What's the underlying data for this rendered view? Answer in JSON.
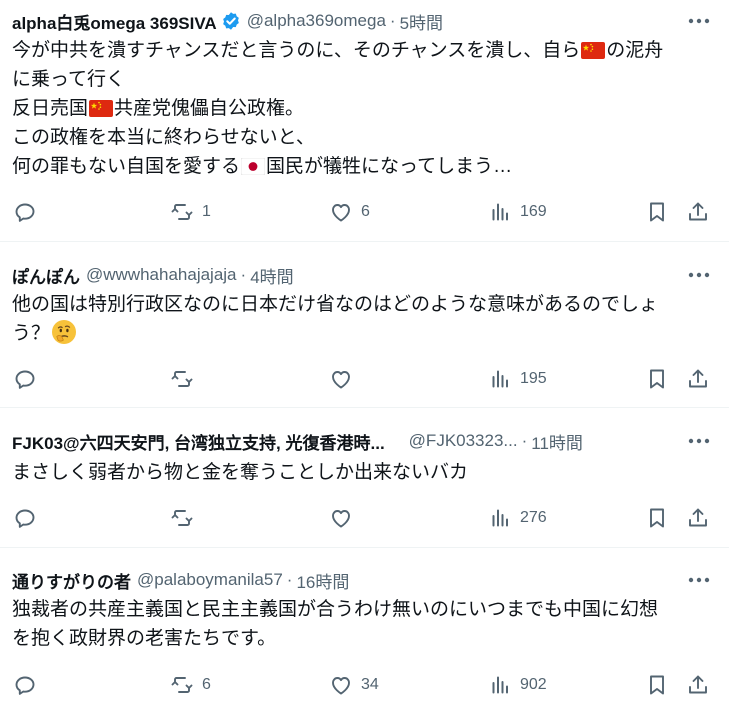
{
  "posts": [
    {
      "display_name": "alpha白兎omega 369SIVA",
      "verified": true,
      "handle": "@alpha369omega",
      "separator": "·",
      "time": "5時間",
      "lines": [
        [
          "今が中共を潰すチャンスだと言うのに、そのチャンスを潰し、自ら",
          "{cn}",
          "の泥舟"
        ],
        [
          "に乗って行く"
        ],
        [
          "反日売国",
          "{cn}",
          "共産党傀儡自公政権。"
        ],
        [
          "この政権を本当に終わらせないと、"
        ],
        [
          "何の罪もない自国を愛する",
          "{jp}",
          "国民が犠牲になってしまう…"
        ]
      ],
      "reply_count": "",
      "repost_count": "1",
      "like_count": "6",
      "view_count": "169"
    },
    {
      "display_name": "ぽんぽん",
      "verified": false,
      "handle": "@wwwhahahajajaja",
      "separator": "·",
      "time": "4時間",
      "lines": [
        [
          "他の国は特別行政区なのに日本だけ省なのはどのような意味があるのでしょ"
        ],
        [
          "う？",
          "{think}"
        ]
      ],
      "reply_count": "",
      "repost_count": "",
      "like_count": "",
      "view_count": "195"
    },
    {
      "display_name": "FJK03@六四天安門, 台湾独立支持, 光復香港時...",
      "verified": false,
      "handle": "@FJK03323...",
      "separator": "·",
      "time": "11時間",
      "lines": [
        [
          "まさしく弱者から物と金を奪うことしか出来ないバカ"
        ]
      ],
      "reply_count": "",
      "repost_count": "",
      "like_count": "",
      "view_count": "276"
    },
    {
      "display_name": "通りすがりの者",
      "verified": false,
      "handle": "@palaboymanila57",
      "separator": "·",
      "time": "16時間",
      "lines": [
        [
          "独裁者の共産主義国と民主主義国が合うわけ無いのにいつまでも中国に幻想"
        ],
        [
          "を抱く政財界の老害たちです。"
        ]
      ],
      "reply_count": "",
      "repost_count": "6",
      "like_count": "34",
      "view_count": "902"
    }
  ],
  "icons": {
    "verified": "verified-badge-icon",
    "more": "more-options-icon",
    "reply": "reply-icon",
    "repost": "repost-icon",
    "like": "like-icon",
    "views": "views-icon",
    "bookmark": "bookmark-icon",
    "share": "share-icon",
    "china_flag": "china-flag-icon",
    "japan_flag": "japan-flag-icon",
    "thinking": "thinking-face-icon"
  },
  "colors": {
    "text": "#0f1419",
    "secondary": "#536471",
    "verified": "#1d9bf0",
    "divider": "#eff3f4",
    "china_red": "#de2910",
    "china_yellow": "#ffde00",
    "japan_red": "#bc002d"
  }
}
